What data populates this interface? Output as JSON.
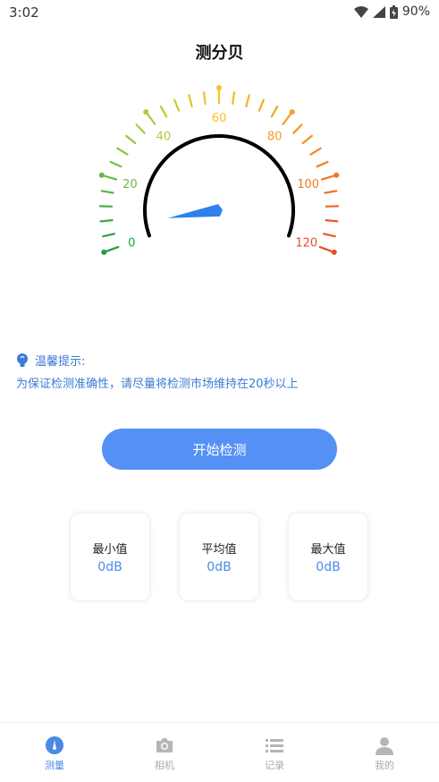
{
  "status": {
    "time": "3:02",
    "battery": "90%"
  },
  "title": "测分贝",
  "gauge": {
    "ticks": [
      "0",
      "20",
      "40",
      "60",
      "80",
      "100",
      "120"
    ],
    "min": 0,
    "max": 120,
    "needle_value": 6.2
  },
  "tip": {
    "title": "温馨提示:",
    "body": "为保证检测准确性，请尽量将检测市场维持在20秒以上"
  },
  "start_button": "开始检测",
  "stats": [
    {
      "label": "最小值",
      "value": "0dB"
    },
    {
      "label": "平均值",
      "value": "0dB"
    },
    {
      "label": "最大值",
      "value": "0dB"
    }
  ],
  "tabs": [
    {
      "label": "测量",
      "icon": "meter-icon",
      "active": true
    },
    {
      "label": "相机",
      "icon": "camera-icon",
      "active": false
    },
    {
      "label": "记录",
      "icon": "list-icon",
      "active": false
    },
    {
      "label": "我的",
      "icon": "user-icon",
      "active": false
    }
  ],
  "colors": {
    "accent": "#5591f5",
    "tip_text": "#3a7bd5",
    "arc": "#000000"
  }
}
